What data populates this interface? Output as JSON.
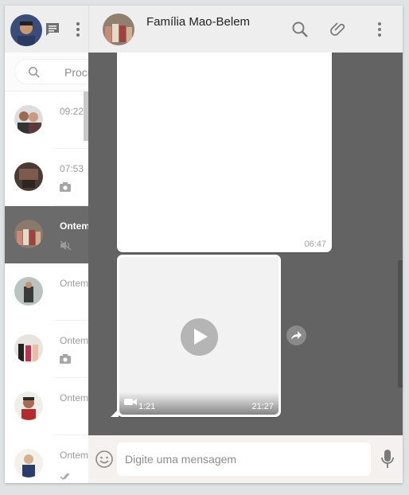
{
  "sidebar": {
    "search": {
      "placeholder": "Procurar ou começar uma nova conversa"
    },
    "chats": [
      {
        "time": "09:22",
        "sub_icon": ""
      },
      {
        "time": "07:53",
        "sub_icon": "camera-icon"
      },
      {
        "time": "Ontem",
        "sub_icon": "muted-icon",
        "active": true
      },
      {
        "time": "Ontem",
        "sub_icon": ""
      },
      {
        "time": "Ontem",
        "sub_icon": "camera-icon"
      },
      {
        "time": "Ontem",
        "sub_icon": ""
      },
      {
        "time": "Ontem",
        "sub_icon": "double-check-icon"
      }
    ]
  },
  "conversation": {
    "title": "Família Mao-Belem",
    "messages": [
      {
        "type": "image",
        "time": "06:47"
      },
      {
        "type": "video",
        "duration": "1:21",
        "time": "21:27"
      }
    ]
  },
  "composer": {
    "placeholder": "Digite uma mensagem"
  },
  "colors": {
    "header_bg": "#eeeeee",
    "active_chat": "#6b6b6b",
    "chat_bg": "#636363",
    "composer_bg": "#f5f1ee"
  }
}
